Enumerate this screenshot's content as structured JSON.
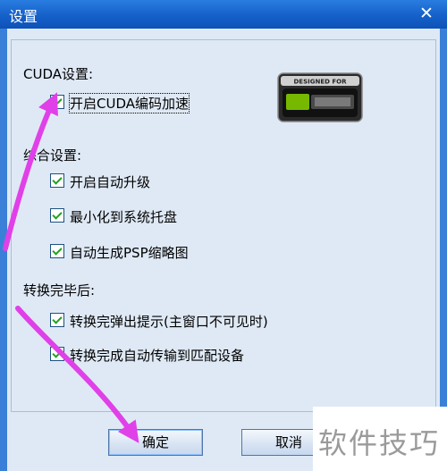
{
  "window": {
    "title": "设置",
    "close_glyph": "✕"
  },
  "cuda": {
    "section_label": "CUDA设置:",
    "enable_label": "开启CUDA编码加速",
    "enable_checked": true,
    "logo_text": "DESIGNED FOR"
  },
  "general": {
    "section_label": "综合设置:",
    "options": [
      {
        "label": "开启自动升级",
        "checked": true
      },
      {
        "label": "最小化到系统托盘",
        "checked": true
      },
      {
        "label": "自动生成PSP缩略图",
        "checked": true
      }
    ]
  },
  "after_convert": {
    "section_label": "转换完毕后:",
    "options": [
      {
        "label": "转换完弹出提示(主窗口不可见时)",
        "checked": true
      },
      {
        "label": "转换完成自动传输到匹配设备",
        "checked": true
      }
    ]
  },
  "buttons": {
    "ok_label": "确定",
    "cancel_label": "取消"
  },
  "watermark": {
    "text": "软件技巧"
  },
  "colors": {
    "title_bar": "#1560c9",
    "arrow": "#e040e8",
    "checkmark": "#21a121"
  },
  "icons": [
    "close-icon",
    "checkbox-checked-icon",
    "nvidia-cuda-logo"
  ]
}
